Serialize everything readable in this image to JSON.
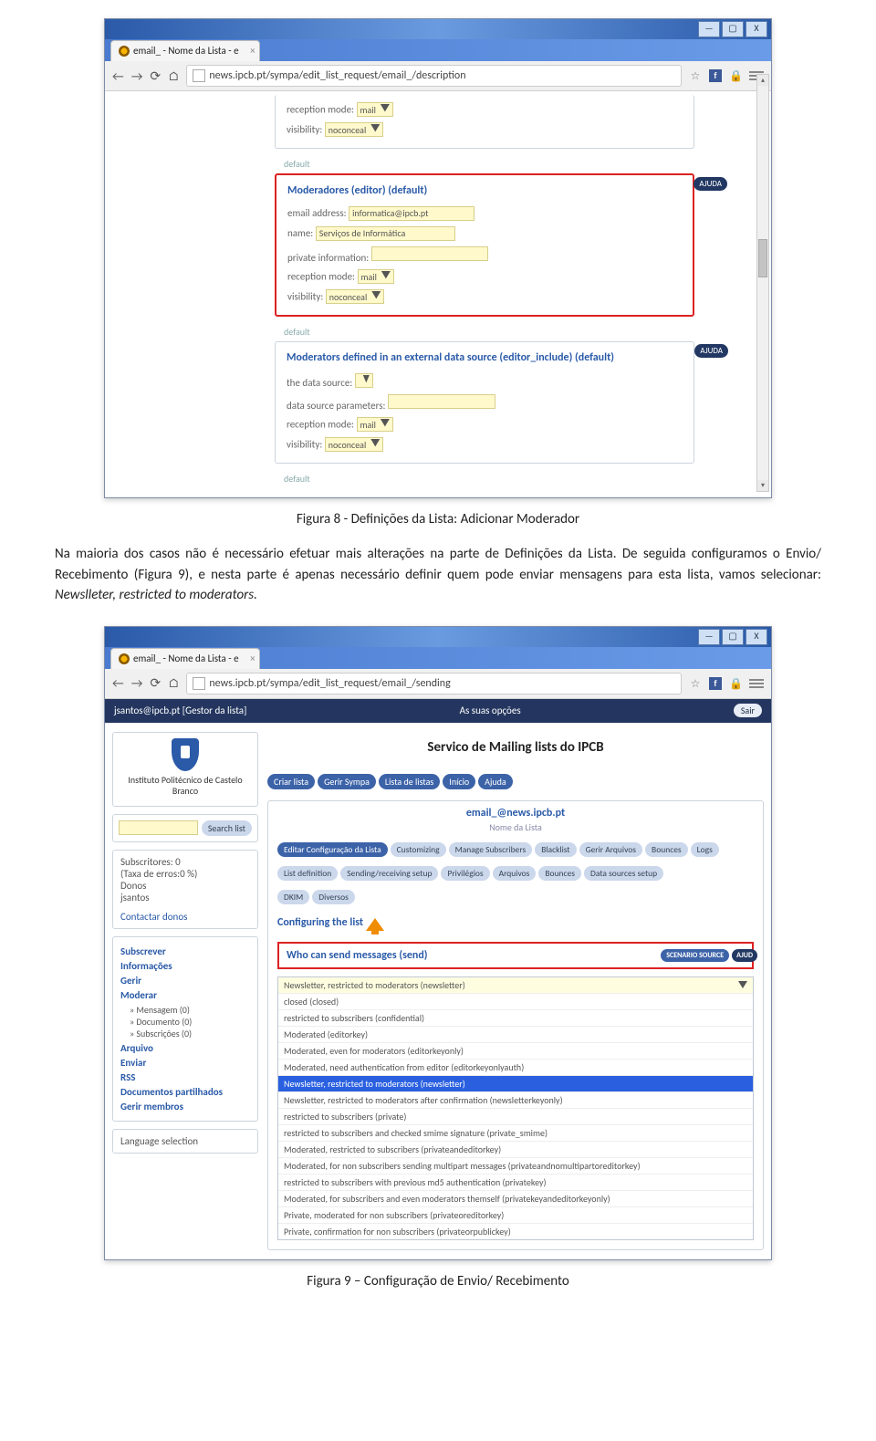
{
  "browser": {
    "tab_title": "email_ - Nome da Lista - e",
    "win_min": "—",
    "win_max": "▢",
    "win_close": "X",
    "url1": "news.ipcb.pt/sympa/edit_list_request/email_/description",
    "url2": "news.ipcb.pt/sympa/edit_list_request/email_/sending",
    "star": "☆",
    "fb": "f",
    "menu": "≡"
  },
  "form1": {
    "recp_label": "reception mode:",
    "recp_val": "mail",
    "vis_label": "visibility:",
    "vis_val": "noconceal",
    "default": "default",
    "mod_title": "Moderadores (editor) (default)",
    "ajuda": "AJUDA",
    "email_lbl": "email address:",
    "email_val": "informatica@ipcb.pt",
    "name_lbl": "name:",
    "name_val": "Serviços de Informática",
    "priv_lbl": "private information:",
    "priv_val": "",
    "ext_title": "Moderators defined in an external data source (editor_include) (default)",
    "ds_lbl": "the data source:",
    "dsp_lbl": "data source parameters:"
  },
  "caption1": "Figura 8 - Definições da Lista: Adicionar Moderador",
  "para1_a": "Na maioria dos casos não é necessário efetuar mais alterações na parte de Definições da Lista. De seguida configuramos o Envio/ Recebimento (Figura 9), e nesta parte é apenas necessário definir quem pode enviar mensagens para esta lista, vamos selecionar: ",
  "para1_b": "Newslleter, restricted to moderators.",
  "shot2": {
    "topleft": "jsantos@ipcb.pt  [Gestor da lista]",
    "topmid": "As suas opções",
    "topbtn": "Sair",
    "institute": "Instituto Politécnico de Castelo Branco",
    "nav": [
      "Criar lista",
      "Gerir Sympa",
      "Lista de listas",
      "Início",
      "Ajuda"
    ],
    "search_btn": "Search list",
    "svc_title": "Servico de Mailing lists do IPCB",
    "listname": "email_@news.ipcb.pt",
    "listsub": "Nome da Lista",
    "sub_info": {
      "subs": "Subscritores: 0",
      "err": "(Taxa de erros:0 %)",
      "don": "Donos",
      "who": "jsantos",
      "contact": "Contactar donos"
    },
    "sidemenu": {
      "subscrever": "Subscrever",
      "info": "Informações",
      "gerir": "Gerir",
      "moderar": "Moderar",
      "msg": "» Mensagem (0)",
      "doc": "» Documento (0)",
      "subsc": "» Subscrições (0)",
      "arquivo": "Arquivo",
      "enviar": "Enviar",
      "rss": "RSS",
      "docs": "Documentos partilhados",
      "membros": "Gerir membros",
      "lang": "Language selection"
    },
    "tabs1": [
      "Editar Configuração da Lista",
      "Customizing",
      "Manage Subscribers",
      "Blacklist",
      "Gerir Arquivos",
      "Bounces",
      "Logs"
    ],
    "tabs2": [
      "List definition",
      "Sending/receiving setup",
      "Privilégios",
      "Arquivos",
      "Bounces",
      "Data sources setup"
    ],
    "tabs3": [
      "DKIM",
      "Diversos"
    ],
    "configuring": "Configuring the list",
    "send_title": "Who can send messages (send)",
    "scenario": "SCENARIO SOURCE",
    "aj": "AJUD",
    "dd_selected": "Newsletter, restricted to moderators (newsletter)",
    "dd_options": [
      {
        "t": "closed (closed)",
        "hl": false
      },
      {
        "t": "restricted to subscribers (confidential)",
        "hl": false
      },
      {
        "t": "Moderated (editorkey)",
        "hl": false
      },
      {
        "t": "Moderated, even for moderators (editorkeyonly)",
        "hl": false
      },
      {
        "t": "Moderated, need authentication from editor (editorkeyonlyauth)",
        "hl": false
      },
      {
        "t": "Newsletter, restricted to moderators (newsletter)",
        "hl": true
      },
      {
        "t": "Newsletter, restricted to moderators after confirmation (newsletterkeyonly)",
        "hl": false
      },
      {
        "t": "restricted to subscribers (private)",
        "hl": false
      },
      {
        "t": "restricted to subscribers and checked smime signature (private_smime)",
        "hl": false
      },
      {
        "t": "Moderated, restricted to subscribers (privateandeditorkey)",
        "hl": false
      },
      {
        "t": "Moderated, for non subscribers sending multipart messages (privateandnomultipartoreditorkey)",
        "hl": false
      },
      {
        "t": "restricted to subscribers with previous md5 authentication (privatekey)",
        "hl": false
      },
      {
        "t": "Moderated, for subscribers and even moderators themself (privatekeyandeditorkeyonly)",
        "hl": false
      },
      {
        "t": "Private, moderated for non subscribers (privateoreditorkey)",
        "hl": false
      },
      {
        "t": "Private, confirmation for non subscribers (privateorpublickey)",
        "hl": false
      }
    ]
  },
  "caption2": "Figura 9 – Configuração de Envio/ Recebimento"
}
